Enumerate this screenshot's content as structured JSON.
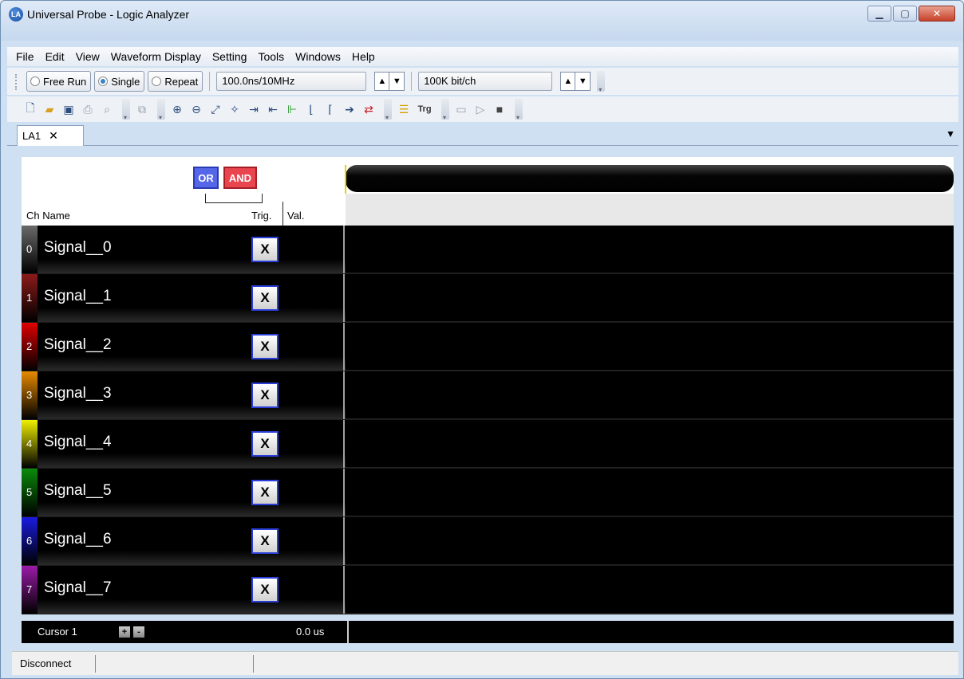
{
  "window": {
    "title": "Universal Probe - Logic Analyzer",
    "icon_text": "LA",
    "buttons": [
      "minimize-icon",
      "maximize-icon",
      "close-icon"
    ]
  },
  "menu": [
    "File",
    "Edit",
    "View",
    "Waveform Display",
    "Setting",
    "Tools",
    "Windows",
    "Help"
  ],
  "toolbar1": {
    "free_run": "Free Run",
    "single": "Single",
    "repeat": "Repeat",
    "selected_mode": "Single",
    "timebase": "100.0ns/10MHz",
    "depth": "100K bit/ch"
  },
  "tab": {
    "label": "LA1"
  },
  "trigger": {
    "or_label": "OR",
    "and_label": "AND"
  },
  "columns": {
    "ch_name": "Ch Name",
    "trig": "Trig.",
    "val": "Val."
  },
  "channels": [
    {
      "num": "0",
      "name": "Signal__0",
      "trig": "X",
      "color": "#6a6a6a"
    },
    {
      "num": "1",
      "name": "Signal__1",
      "trig": "X",
      "color": "#8b1a1a"
    },
    {
      "num": "2",
      "name": "Signal__2",
      "trig": "X",
      "color": "#e00000"
    },
    {
      "num": "3",
      "name": "Signal__3",
      "trig": "X",
      "color": "#e88a00"
    },
    {
      "num": "4",
      "name": "Signal__4",
      "trig": "X",
      "color": "#f0f000"
    },
    {
      "num": "5",
      "name": "Signal__5",
      "trig": "X",
      "color": "#0a8a0a"
    },
    {
      "num": "6",
      "name": "Signal__6",
      "trig": "X",
      "color": "#1a1ae0"
    },
    {
      "num": "7",
      "name": "Signal__7",
      "trig": "X",
      "color": "#9a1aa8"
    }
  ],
  "cursor": {
    "label": "Cursor 1",
    "plus": "+",
    "minus": "-",
    "value": "0.0  us"
  },
  "status": {
    "text": "Disconnect"
  }
}
